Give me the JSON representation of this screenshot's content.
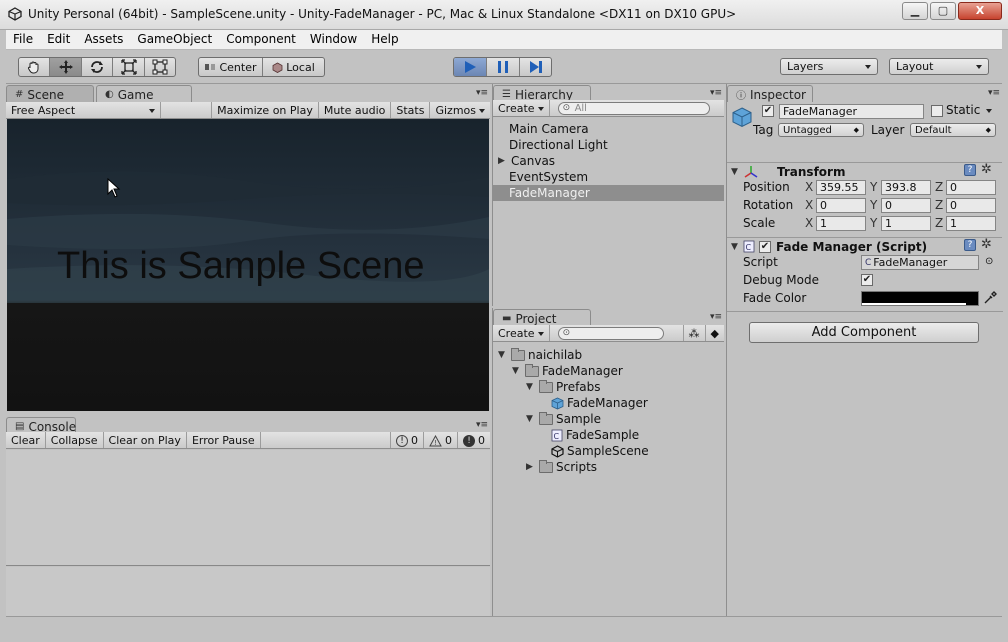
{
  "window": {
    "title": "Unity Personal (64bit) - SampleScene.unity - Unity-FadeManager - PC, Mac & Linux Standalone <DX11 on DX10 GPU>",
    "minimize_glyph": "▁",
    "maximize_glyph": "▢",
    "close_glyph": "X"
  },
  "menu": [
    "File",
    "Edit",
    "Assets",
    "GameObject",
    "Component",
    "Window",
    "Help"
  ],
  "toolbar": {
    "center_label": "Center",
    "local_label": "Local",
    "layers_label": "Layers",
    "layout_label": "Layout"
  },
  "scene_panel": {
    "tabs": [
      "Scene",
      "Game"
    ],
    "active_tab": "Game",
    "aspect": "Free Aspect",
    "maximize_on_play": "Maximize on Play",
    "mute_audio": "Mute audio",
    "stats": "Stats",
    "gizmos": "Gizmos",
    "game_text": "This is Sample Scene"
  },
  "console_panel": {
    "tab": "Console",
    "clear": "Clear",
    "collapse": "Collapse",
    "clear_on_play": "Clear on Play",
    "error_pause": "Error Pause",
    "info_count": "0",
    "warning_count": "0",
    "error_count": "0"
  },
  "hierarchy": {
    "tab": "Hierarchy",
    "create": "Create",
    "search_placeholder": "All",
    "items": [
      "Main Camera",
      "Directional Light",
      "Canvas",
      "EventSystem",
      "FadeManager"
    ],
    "selected": "FadeManager"
  },
  "project": {
    "tab": "Project",
    "create": "Create",
    "tree": [
      "naichilab",
      "FadeManager",
      "Prefabs",
      "FadeManager",
      "Sample",
      "FadeSample",
      "SampleScene",
      "Scripts"
    ]
  },
  "inspector": {
    "tab": "Inspector",
    "object_name": "FadeManager",
    "active_checked": true,
    "static_label": "Static",
    "tag_label": "Tag",
    "tag_value": "Untagged",
    "layer_label": "Layer",
    "layer_value": "Default",
    "transform": {
      "title": "Transform",
      "position_label": "Position",
      "rotation_label": "Rotation",
      "scale_label": "Scale",
      "axis_x": "X",
      "axis_y": "Y",
      "axis_z": "Z",
      "position": [
        "359.55",
        "393.8",
        "0"
      ],
      "rotation": [
        "0",
        "0",
        "0"
      ],
      "scale": [
        "1",
        "1",
        "1"
      ]
    },
    "fade_script": {
      "title": "Fade Manager (Script)",
      "script_label": "Script",
      "script_value": "FadeManager",
      "debug_mode_label": "Debug Mode",
      "debug_mode": true,
      "fade_color_label": "Fade Color",
      "fade_color": "#000000"
    },
    "add_component": "Add Component"
  },
  "colors": {
    "editor_bg": "#c2c2c2",
    "selection": "#8e8e8e",
    "play_active": "#7b96c4",
    "game_sky_top": "#1a2733",
    "game_ground": "#141414"
  }
}
